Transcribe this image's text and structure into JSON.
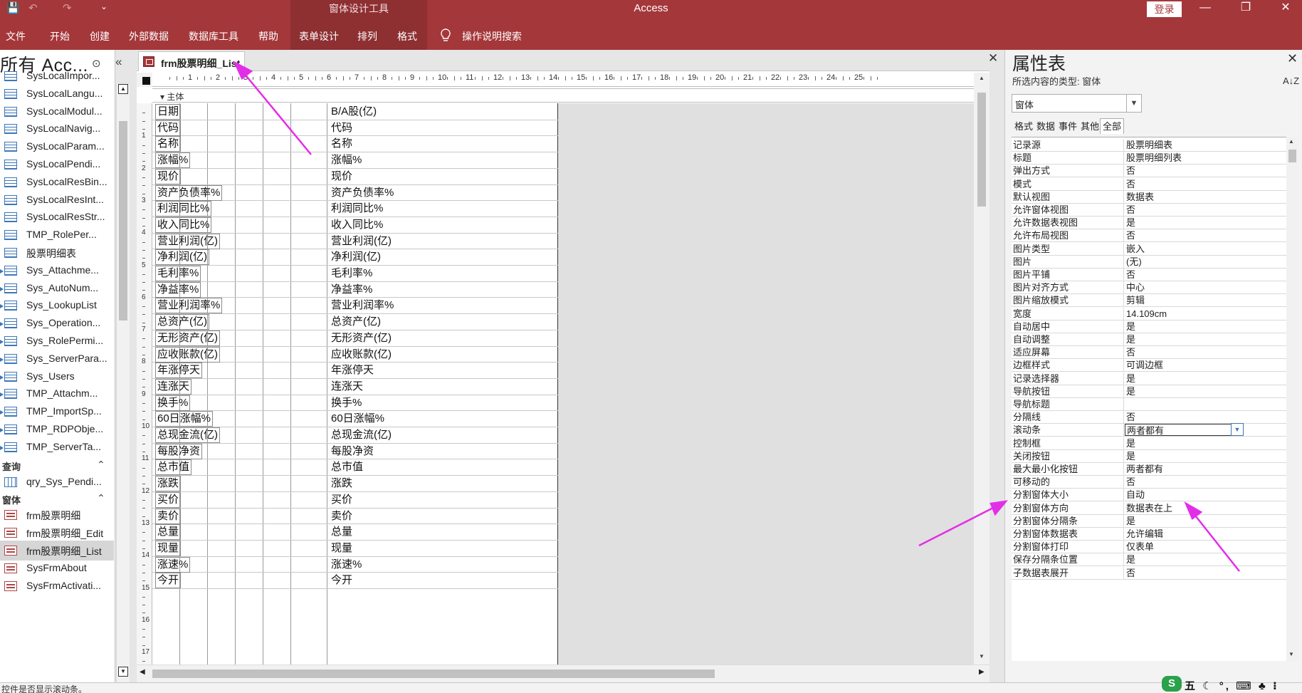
{
  "window": {
    "app_title": "Access",
    "context_tab_group": "窗体设计工具",
    "login_label": "登录",
    "minimize_glyph": "—",
    "restore_glyph": "❐",
    "close_glyph": "✕"
  },
  "quick_access": {
    "save_glyph": "💾",
    "undo_glyph": "↶",
    "redo_glyph": "↷",
    "customize_glyph": "⌄"
  },
  "ribbon_tabs": [
    "文件",
    "开始",
    "创建",
    "外部数据",
    "数据库工具",
    "帮助",
    "表单设计",
    "排列",
    "格式"
  ],
  "tell_me": "操作说明搜索",
  "nav": {
    "title": "所有 Acc...",
    "menu_glyph": "⊙",
    "collapse_glyph": "«",
    "items_tables": [
      {
        "label": "SysLocalImpor...",
        "linked": false
      },
      {
        "label": "SysLocalLangu...",
        "linked": false
      },
      {
        "label": "SysLocalModul...",
        "linked": false
      },
      {
        "label": "SysLocalNavig...",
        "linked": false
      },
      {
        "label": "SysLocalParam...",
        "linked": false
      },
      {
        "label": "SysLocalPendi...",
        "linked": false
      },
      {
        "label": "SysLocalResBin...",
        "linked": false
      },
      {
        "label": "SysLocalResInt...",
        "linked": false
      },
      {
        "label": "SysLocalResStr...",
        "linked": false
      },
      {
        "label": "TMP_RolePer...",
        "linked": false
      },
      {
        "label": "股票明细表",
        "linked": false
      },
      {
        "label": "Sys_Attachme...",
        "linked": true
      },
      {
        "label": "Sys_AutoNum...",
        "linked": true
      },
      {
        "label": "Sys_LookupList",
        "linked": true
      },
      {
        "label": "Sys_Operation...",
        "linked": true
      },
      {
        "label": "Sys_RolePermi...",
        "linked": true
      },
      {
        "label": "Sys_ServerPara...",
        "linked": true
      },
      {
        "label": "Sys_Users",
        "linked": true
      },
      {
        "label": "TMP_Attachm...",
        "linked": true
      },
      {
        "label": "TMP_ImportSp...",
        "linked": true
      },
      {
        "label": "TMP_RDPObje...",
        "linked": true
      },
      {
        "label": "TMP_ServerTa...",
        "linked": true
      }
    ],
    "group_queries": "查询",
    "items_queries": [
      "qry_Sys_Pendi..."
    ],
    "group_forms": "窗体",
    "items_forms": [
      "frm股票明细",
      "frm股票明细_Edit",
      "frm股票明细_List",
      "SysFrmAbout",
      "SysFrmActivati..."
    ],
    "selected_form": "frm股票明细_List"
  },
  "document": {
    "tab_label": "frm股票明细_List",
    "section_label": "主体",
    "ruler_numbers": [
      "1",
      "2",
      "3",
      "4",
      "5",
      "6",
      "7",
      "8",
      "9",
      "10",
      "11",
      "12",
      "13",
      "14",
      "15",
      "16",
      "17",
      "18",
      "19",
      "20",
      "21",
      "22",
      "23",
      "24",
      "25"
    ],
    "vruler_numbers": [
      "1",
      "2",
      "3",
      "4",
      "5",
      "6",
      "7",
      "8",
      "9",
      "10",
      "11",
      "12",
      "13",
      "14",
      "15",
      "16",
      "17"
    ],
    "fields": [
      {
        "label": "日期",
        "control": "B/A股(亿)"
      },
      {
        "label": "代码",
        "control": "代码"
      },
      {
        "label": "名称",
        "control": "名称"
      },
      {
        "label": "涨幅%",
        "control": "涨幅%"
      },
      {
        "label": "现价",
        "control": "现价"
      },
      {
        "label": "资产负债率%",
        "control": "资产负债率%"
      },
      {
        "label": "利润同比%",
        "control": "利润同比%"
      },
      {
        "label": "收入同比%",
        "control": "收入同比%"
      },
      {
        "label": "营业利润(亿)",
        "control": "营业利润(亿)"
      },
      {
        "label": "净利润(亿)",
        "control": "净利润(亿)"
      },
      {
        "label": "毛利率%",
        "control": "毛利率%"
      },
      {
        "label": "净益率%",
        "control": "净益率%"
      },
      {
        "label": "营业利润率%",
        "control": "营业利润率%"
      },
      {
        "label": "总资产(亿)",
        "control": "总资产(亿)"
      },
      {
        "label": "无形资产(亿)",
        "control": "无形资产(亿)"
      },
      {
        "label": "应收账款(亿)",
        "control": "应收账款(亿)"
      },
      {
        "label": "年涨停天",
        "control": "年涨停天"
      },
      {
        "label": "连涨天",
        "control": "连涨天"
      },
      {
        "label": "换手%",
        "control": "换手%"
      },
      {
        "label": "60日涨幅%",
        "control": "60日涨幅%"
      },
      {
        "label": "总现金流(亿)",
        "control": "总现金流(亿)"
      },
      {
        "label": "每股净资",
        "control": "每股净资"
      },
      {
        "label": "总市值",
        "control": "总市值"
      },
      {
        "label": "涨跌",
        "control": "涨跌"
      },
      {
        "label": "买价",
        "control": "买价"
      },
      {
        "label": "卖价",
        "control": "卖价"
      },
      {
        "label": "总量",
        "control": "总量"
      },
      {
        "label": "现量",
        "control": "现量"
      },
      {
        "label": "涨速%",
        "control": "涨速%"
      },
      {
        "label": "今开",
        "control": "今开"
      }
    ]
  },
  "property_sheet": {
    "title": "属性表",
    "selection_type": "所选内容的类型: 窗体",
    "sort_glyph": "A↓Z",
    "selector_value": "窗体",
    "tabs": [
      "格式",
      "数据",
      "事件",
      "其他",
      "全部"
    ],
    "active_tab": "全部",
    "properties": [
      {
        "k": "记录源",
        "v": "股票明细表"
      },
      {
        "k": "标题",
        "v": "股票明细列表"
      },
      {
        "k": "弹出方式",
        "v": "否"
      },
      {
        "k": "模式",
        "v": "否"
      },
      {
        "k": "默认视图",
        "v": "数据表"
      },
      {
        "k": "允许窗体视图",
        "v": "否"
      },
      {
        "k": "允许数据表视图",
        "v": "是"
      },
      {
        "k": "允许布局视图",
        "v": "否"
      },
      {
        "k": "图片类型",
        "v": "嵌入"
      },
      {
        "k": "图片",
        "v": "(无)"
      },
      {
        "k": "图片平铺",
        "v": "否"
      },
      {
        "k": "图片对齐方式",
        "v": "中心"
      },
      {
        "k": "图片缩放模式",
        "v": "剪辑"
      },
      {
        "k": "宽度",
        "v": "14.109cm"
      },
      {
        "k": "自动居中",
        "v": "是"
      },
      {
        "k": "自动调整",
        "v": "是"
      },
      {
        "k": "适应屏幕",
        "v": "否"
      },
      {
        "k": "边框样式",
        "v": "可调边框"
      },
      {
        "k": "记录选择器",
        "v": "是"
      },
      {
        "k": "导航按钮",
        "v": "是"
      },
      {
        "k": "导航标题",
        "v": ""
      },
      {
        "k": "分隔线",
        "v": "否"
      },
      {
        "k": "滚动条",
        "v": "两者都有"
      },
      {
        "k": "控制框",
        "v": "是"
      },
      {
        "k": "关闭按钮",
        "v": "是"
      },
      {
        "k": "最大最小化按钮",
        "v": "两者都有"
      },
      {
        "k": "可移动的",
        "v": "否"
      },
      {
        "k": "分割窗体大小",
        "v": "自动"
      },
      {
        "k": "分割窗体方向",
        "v": "数据表在上"
      },
      {
        "k": "分割窗体分隔条",
        "v": "是"
      },
      {
        "k": "分割窗体数据表",
        "v": "允许编辑"
      },
      {
        "k": "分割窗体打印",
        "v": "仅表单"
      },
      {
        "k": "保存分隔条位置",
        "v": "是"
      },
      {
        "k": "子数据表展开",
        "v": "否"
      }
    ],
    "selected_property": "滚动条"
  },
  "status": {
    "message": "控件是否显示滚动条。",
    "ime_text": "五 ☾ °, ⌨ ♣ ⁝"
  },
  "colors": {
    "accent": "#a4373a",
    "annotation_arrow": "#e32ee8"
  }
}
